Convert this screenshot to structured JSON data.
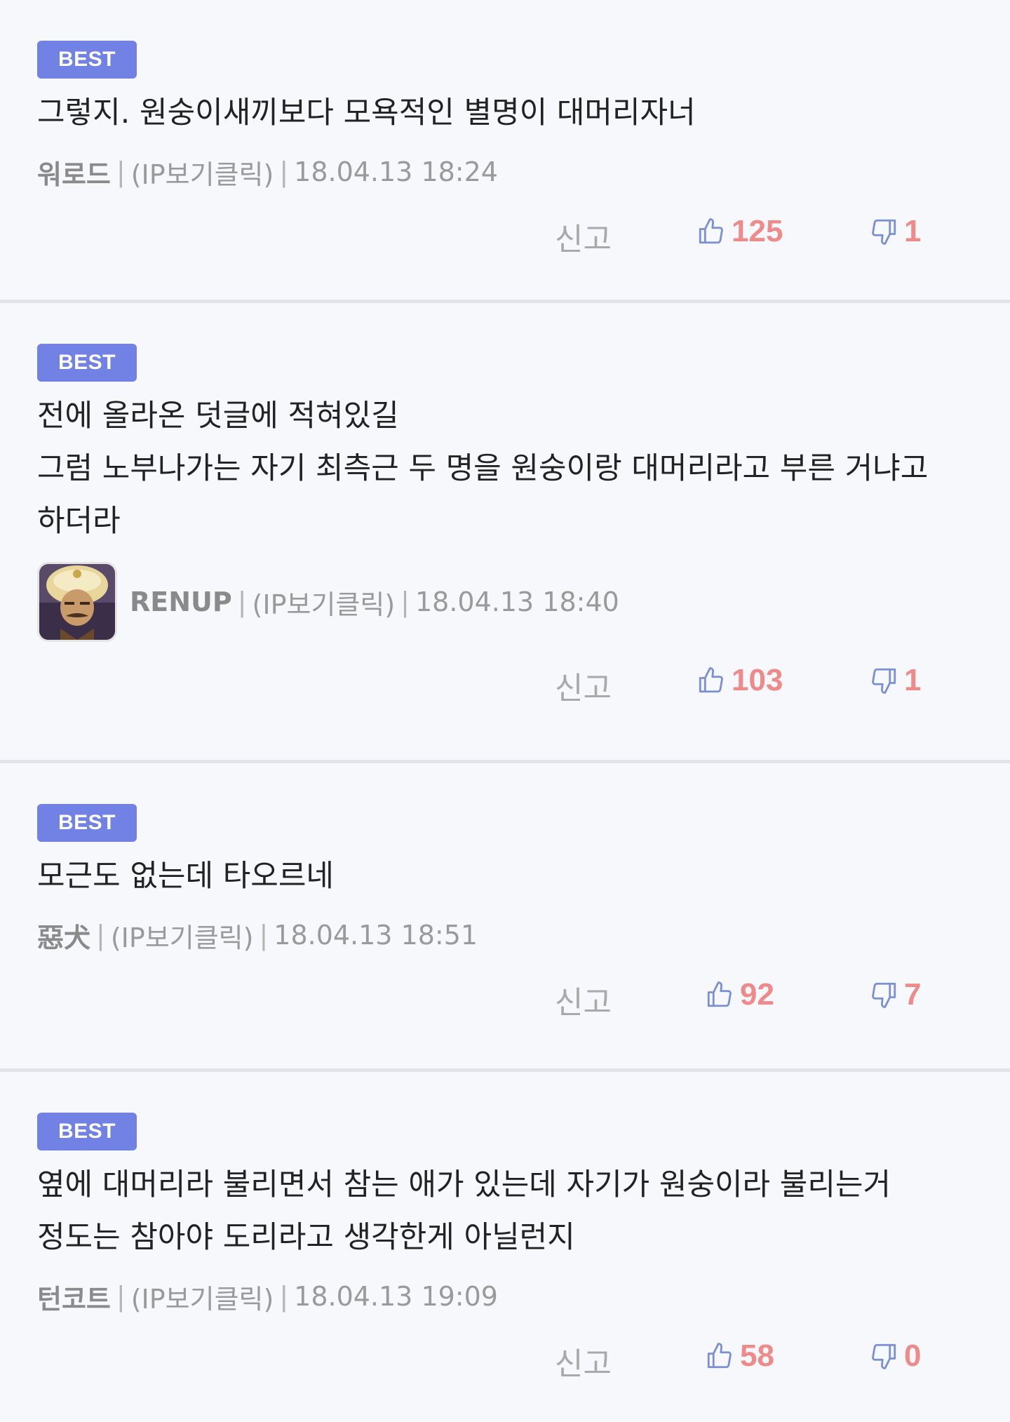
{
  "comments": [
    {
      "badge": "BEST",
      "text": "그렇지. 원숭이새끼보다 모욕적인 별명이 대머리자너",
      "nickname": "워로드",
      "ip": "(IP보기클릭)",
      "timestamp": "18.04.13 18:24",
      "report_label": "신고",
      "upvotes": "125",
      "downvotes": "1",
      "has_avatar": false
    },
    {
      "badge": "BEST",
      "text": "전에 올라온 덧글에 적혀있길\n그럼 노부나가는 자기 최측근 두 명을 원숭이랑 대머리라고 부른 거냐고 하더라",
      "nickname": "RENUP",
      "ip": "(IP보기클릭)",
      "timestamp": "18.04.13 18:40",
      "report_label": "신고",
      "upvotes": "103",
      "downvotes": "1",
      "has_avatar": true
    },
    {
      "badge": "BEST",
      "text": "모근도 없는데 타오르네",
      "nickname": "惡犬",
      "ip": "(IP보기클릭)",
      "timestamp": "18.04.13 18:51",
      "report_label": "신고",
      "upvotes": "92",
      "downvotes": "7",
      "has_avatar": false
    },
    {
      "badge": "BEST",
      "text": "옆에 대머리라 불리면서 참는 애가 있는데 자기가 원숭이라 불리는거 정도는 참아야 도리라고 생각한게 아닐런지",
      "nickname": "턴코트",
      "ip": "(IP보기클릭)",
      "timestamp": "18.04.13 19:09",
      "report_label": "신고",
      "upvotes": "58",
      "downvotes": "0",
      "has_avatar": false
    }
  ],
  "icons": {
    "thumb_up": "thumbs-up-icon",
    "thumb_down": "thumbs-down-icon"
  },
  "colors": {
    "badge": "#7282e4",
    "vote_count": "#ee8a8a",
    "icon_stroke": "#7a8fd6",
    "background": "#f7f8fc",
    "divider": "#e2e4ea"
  }
}
